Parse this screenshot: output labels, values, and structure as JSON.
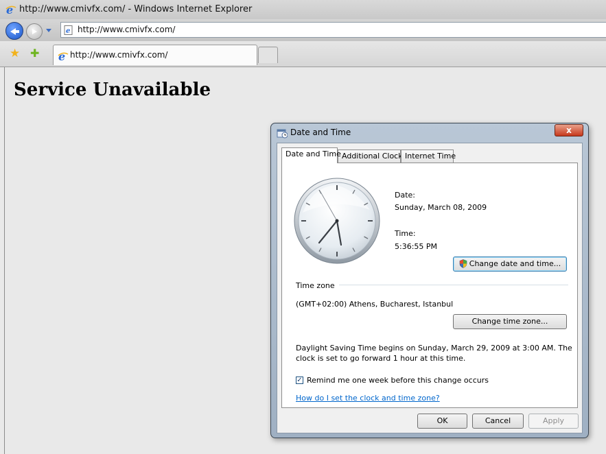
{
  "window": {
    "title": "http://www.cmivfx.com/ - Windows Internet Explorer"
  },
  "navigation": {
    "address": "http://www.cmivfx.com/"
  },
  "tabs": [
    {
      "label": "http://www.cmivfx.com/"
    }
  ],
  "page": {
    "heading": "Service Unavailable"
  },
  "dialog": {
    "title": "Date and Time",
    "close_label": "x",
    "tabs": [
      "Date and Time",
      "Additional Clocks",
      "Internet Time"
    ],
    "date_label": "Date:",
    "date_value": "Sunday, March 08, 2009",
    "time_label": "Time:",
    "time_value": "5:36:55 PM",
    "change_datetime_button": "Change date and time...",
    "timezone_section": "Time zone",
    "timezone_value": "(GMT+02:00) Athens, Bucharest, Istanbul",
    "change_timezone_button": "Change time zone...",
    "dst_line1": "Daylight Saving Time begins on Sunday, March 29, 2009 at 3:00 AM. The",
    "dst_line2": "clock is set to go forward 1 hour at this time.",
    "remind_checkbox": {
      "label": "Remind me one week before this change occurs",
      "checked": true
    },
    "help_link": "How do I set the clock and time zone?",
    "ok_button": "OK",
    "cancel_button": "Cancel",
    "apply_button": "Apply"
  }
}
